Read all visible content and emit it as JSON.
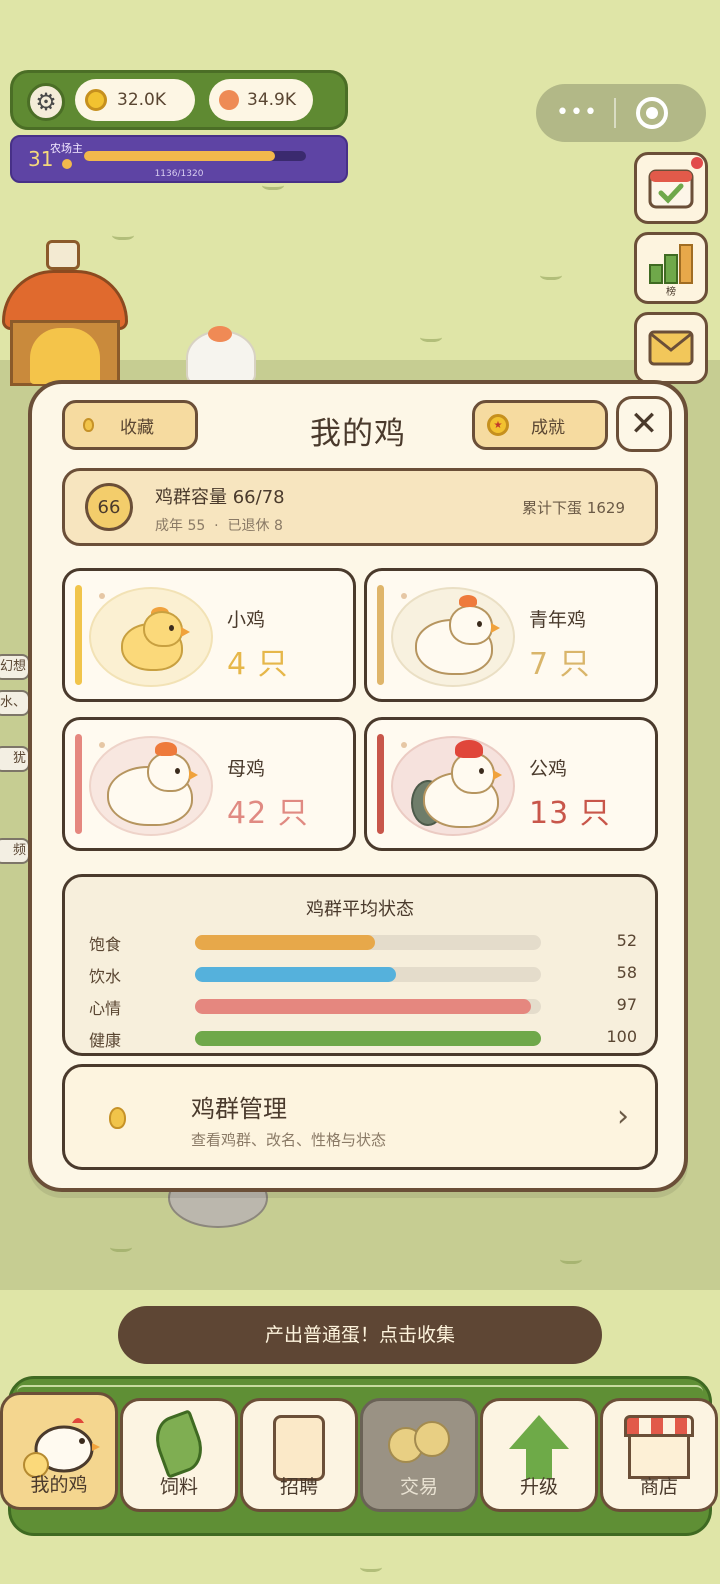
{
  "hud": {
    "coins": "32.0K",
    "gems": "34.9K",
    "level": "31",
    "level_title": "农场主",
    "xp_text": "1136/1320",
    "xp_fraction": 0.86
  },
  "side_buttons": [
    {
      "name": "daily-checkin",
      "icon": "calendar-check-icon",
      "has_badge": true
    },
    {
      "name": "leaderboard",
      "icon": "bar-chart-icon",
      "label": "榜"
    },
    {
      "name": "mail",
      "icon": "envelope-icon"
    }
  ],
  "background_chips": [
    "幻想",
    "水、",
    "犹",
    "频"
  ],
  "panel": {
    "title": "我的鸡",
    "collection_label": "收藏",
    "achievement_label": "成就",
    "close_label": "✕",
    "capacity": {
      "badge": "66",
      "title": "鸡群容量 66/78",
      "adult": "成年 55",
      "separator": "·",
      "retired": "已退休 8",
      "total_eggs": "累计下蛋 1629"
    },
    "cards": [
      {
        "name": "小鸡",
        "count": "4 只",
        "accent": "#f1c44a",
        "count_color": "#e6b74a"
      },
      {
        "name": "青年鸡",
        "count": "7 只",
        "accent": "#dfb56a",
        "count_color": "#d9b56a"
      },
      {
        "name": "母鸡",
        "count": "42 只",
        "accent": "#e5877f",
        "count_color": "#e08a82"
      },
      {
        "name": "公鸡",
        "count": "13 只",
        "accent": "#c8564a",
        "count_color": "#c8564a"
      }
    ],
    "status": {
      "title": "鸡群平均状态",
      "rows": [
        {
          "label": "饱食",
          "value": "52",
          "color": "#e7a84a"
        },
        {
          "label": "饮水",
          "value": "58",
          "color": "#55b1dc"
        },
        {
          "label": "心情",
          "value": "97",
          "color": "#e5877f"
        },
        {
          "label": "健康",
          "value": "100",
          "color": "#6fa84a"
        }
      ]
    },
    "manage": {
      "title": "鸡群管理",
      "subtitle": "查看鸡群、改名、性格与状态",
      "arrow": "›"
    }
  },
  "toast": "产出普通蛋！点击收集",
  "nav": [
    {
      "label": "我的鸡",
      "icon": "chicken-icon",
      "state": "active"
    },
    {
      "label": "饲料",
      "icon": "leaf-icon",
      "state": "normal"
    },
    {
      "label": "招聘",
      "icon": "id-badge-icon",
      "state": "normal"
    },
    {
      "label": "交易",
      "icon": "exchange-icon",
      "state": "disabled"
    },
    {
      "label": "升级",
      "icon": "arrow-up-icon",
      "state": "normal"
    },
    {
      "label": "商店",
      "icon": "shop-icon",
      "state": "normal"
    }
  ]
}
